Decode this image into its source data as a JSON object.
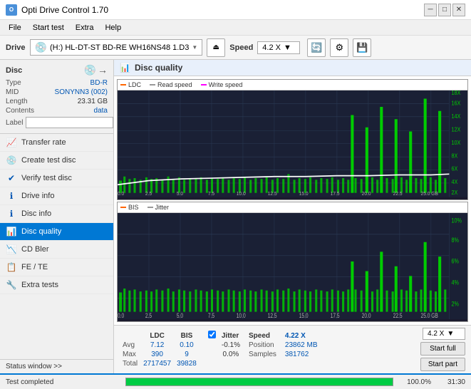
{
  "app": {
    "title": "Opti Drive Control 1.70",
    "icon": "O"
  },
  "titlebar": {
    "minimize": "─",
    "maximize": "□",
    "close": "✕"
  },
  "menu": {
    "items": [
      "File",
      "Start test",
      "Extra",
      "Help"
    ]
  },
  "drive_bar": {
    "label": "Drive",
    "drive_value": "(H:)  HL-DT-ST BD-RE  WH16NS48 1.D3",
    "speed_label": "Speed",
    "speed_value": "4.2 X"
  },
  "disc": {
    "title": "Disc",
    "type_label": "Type",
    "type_value": "BD-R",
    "mid_label": "MID",
    "mid_value": "SONYNN3 (002)",
    "length_label": "Length",
    "length_value": "23.31 GB",
    "contents_label": "Contents",
    "contents_value": "data",
    "label_label": "Label",
    "label_placeholder": ""
  },
  "sidebar_items": [
    {
      "id": "transfer-rate",
      "label": "Transfer rate",
      "icon": "📈"
    },
    {
      "id": "create-test-disc",
      "label": "Create test disc",
      "icon": "💿"
    },
    {
      "id": "verify-test-disc",
      "label": "Verify test disc",
      "icon": "✔"
    },
    {
      "id": "drive-info",
      "label": "Drive info",
      "icon": "ℹ"
    },
    {
      "id": "disc-info",
      "label": "Disc info",
      "icon": "ℹ"
    },
    {
      "id": "disc-quality",
      "label": "Disc quality",
      "icon": "📊",
      "active": true
    },
    {
      "id": "cd-bler",
      "label": "CD Bler",
      "icon": "📉"
    },
    {
      "id": "fe-te",
      "label": "FE / TE",
      "icon": "📋"
    },
    {
      "id": "extra-tests",
      "label": "Extra tests",
      "icon": "🔧"
    }
  ],
  "status_window": "Status window >>",
  "chart_title": "Disc quality",
  "chart1": {
    "legend": [
      "LDC",
      "Read speed",
      "Write speed"
    ],
    "y_max": 400,
    "y_labels_right": [
      "18X",
      "16X",
      "14X",
      "12X",
      "10X",
      "8X",
      "6X",
      "4X",
      "2X"
    ],
    "x_labels": [
      "0.0",
      "2.5",
      "5.0",
      "7.5",
      "10.0",
      "12.5",
      "15.0",
      "17.5",
      "20.0",
      "22.5",
      "25.0 GB"
    ]
  },
  "chart2": {
    "legend": [
      "BIS",
      "Jitter"
    ],
    "y_max": 10,
    "y_labels_right": [
      "10%",
      "8%",
      "6%",
      "4%",
      "2%"
    ],
    "x_labels": [
      "0.0",
      "2.5",
      "5.0",
      "7.5",
      "10.0",
      "12.5",
      "15.0",
      "17.5",
      "20.0",
      "22.5",
      "25.0 GB"
    ]
  },
  "stats": {
    "ldc_label": "LDC",
    "bis_label": "BIS",
    "jitter_label": "Jitter",
    "jitter_checked": true,
    "speed_label": "Speed",
    "speed_value": "4.22 X",
    "speed_select": "4.2 X",
    "avg_label": "Avg",
    "avg_ldc": "7.12",
    "avg_bis": "0.10",
    "avg_jitter": "-0.1%",
    "max_label": "Max",
    "max_ldc": "390",
    "max_bis": "9",
    "max_jitter": "0.0%",
    "total_label": "Total",
    "total_ldc": "2717457",
    "total_bis": "39828",
    "position_label": "Position",
    "position_value": "23862 MB",
    "samples_label": "Samples",
    "samples_value": "381762"
  },
  "buttons": {
    "start_full": "Start full",
    "start_part": "Start part"
  },
  "bottom_status": {
    "text": "Test completed",
    "progress": 100,
    "progress_text": "100.0%",
    "time": "31:30"
  }
}
